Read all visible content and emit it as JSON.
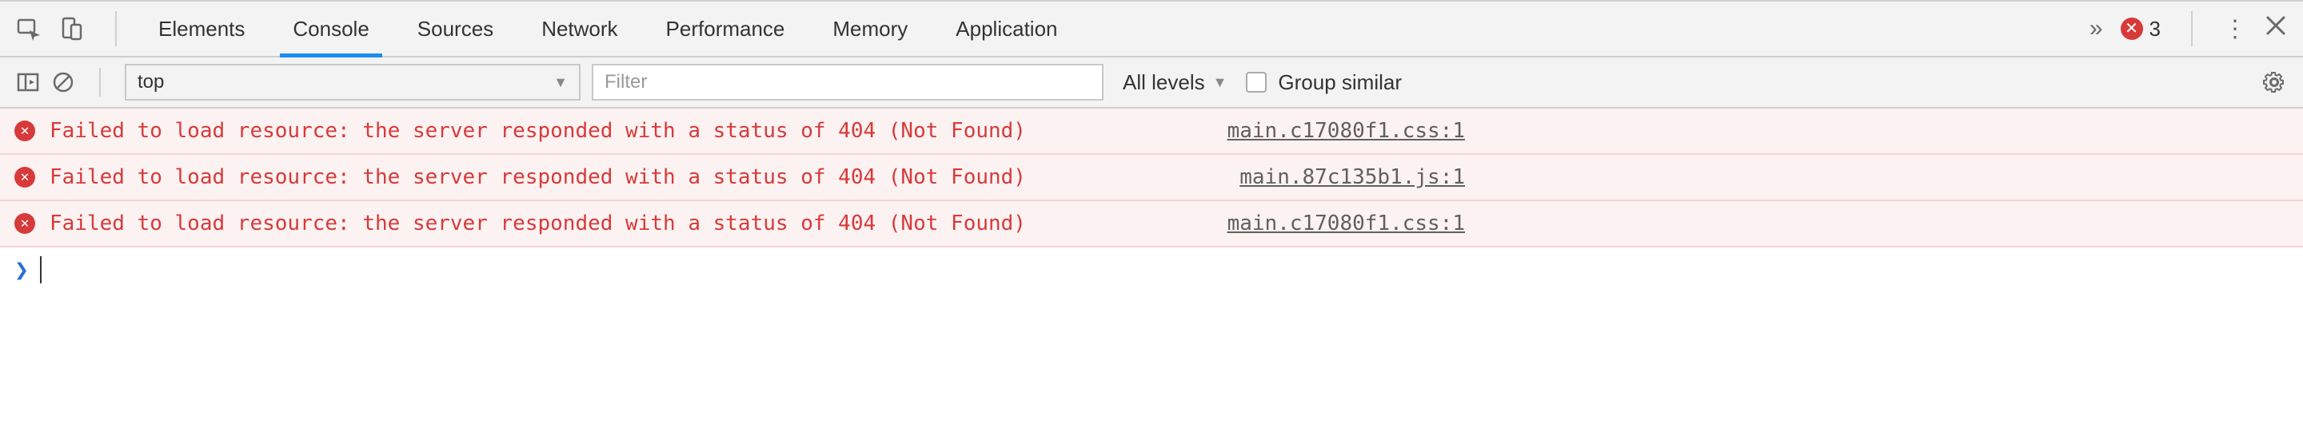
{
  "tabbar": {
    "tabs": [
      {
        "label": "Elements",
        "active": false
      },
      {
        "label": "Console",
        "active": true
      },
      {
        "label": "Sources",
        "active": false
      },
      {
        "label": "Network",
        "active": false
      },
      {
        "label": "Performance",
        "active": false
      },
      {
        "label": "Memory",
        "active": false
      },
      {
        "label": "Application",
        "active": false
      }
    ],
    "error_count": "3"
  },
  "toolbar": {
    "context": "top",
    "filter_placeholder": "Filter",
    "levels_label": "All levels",
    "group_similar_label": "Group similar",
    "group_similar_checked": false
  },
  "messages": [
    {
      "text": "Failed to load resource: the server responded with a status of 404 (Not Found)",
      "source": "main.c17080f1.css:1"
    },
    {
      "text": "Failed to load resource: the server responded with a status of 404 (Not Found)",
      "source": "main.87c135b1.js:1"
    },
    {
      "text": "Failed to load resource: the server responded with a status of 404 (Not Found)",
      "source": "main.c17080f1.css:1"
    }
  ],
  "prompt": {
    "symbol": "❯"
  }
}
